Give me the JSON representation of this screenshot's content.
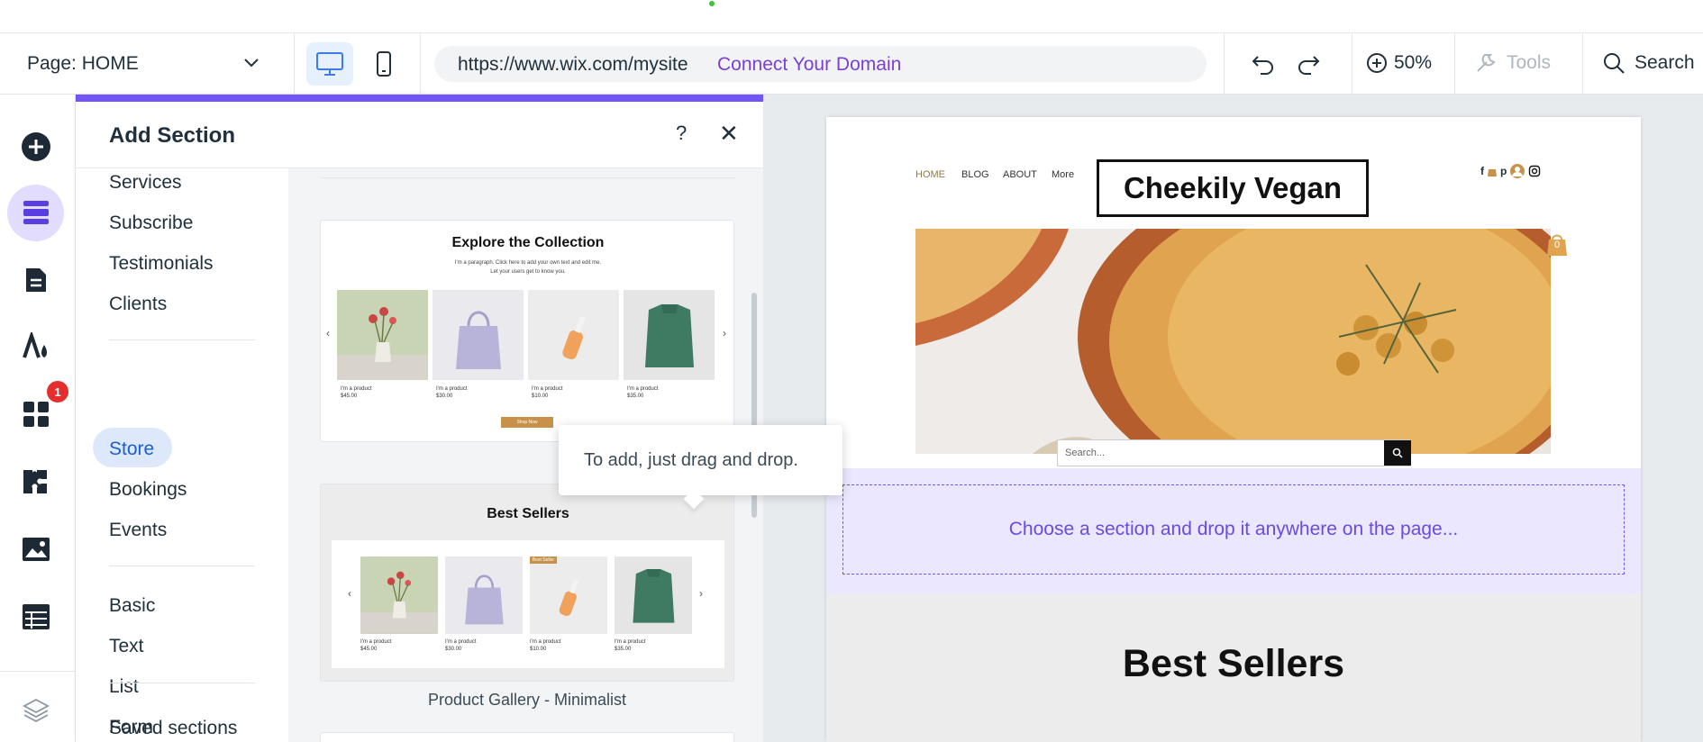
{
  "toolbar": {
    "page_label": "Page: HOME",
    "url": "https://www.wix.com/mysite",
    "connect_domain": "Connect Your Domain",
    "zoom": "50%",
    "tools": "Tools",
    "search": "Search"
  },
  "rail": {
    "apps_badge": "1",
    "icons": [
      "add-icon",
      "sections-icon",
      "pages-icon",
      "design-icon",
      "apps-icon",
      "business-icon",
      "media-icon",
      "cms-icon",
      "layers-icon"
    ]
  },
  "panel": {
    "title": "Add Section",
    "help": "?",
    "close": "✕",
    "categories_group1": [
      "Services",
      "Subscribe",
      "Testimonials",
      "Clients"
    ],
    "categories_group2": [
      "Store",
      "Bookings",
      "Events"
    ],
    "categories_group3": [
      "Basic",
      "Text",
      "List",
      "Form"
    ],
    "saved_sections": "Saved sections",
    "selected_category": "Store"
  },
  "previews": {
    "card1": {
      "title": "Explore the Collection",
      "subtitle_line1": "I'm a paragraph. Click here to add your own text and edit me.",
      "subtitle_line2": "Let your users get to know you.",
      "product_name": "I'm a product",
      "prices": [
        "$45.00",
        "$30.00",
        "$10.00",
        "$35.00"
      ],
      "button": "Shop Now"
    },
    "card2": {
      "title": "Best Sellers",
      "product_name": "I'm a product",
      "prices": [
        "$45.00",
        "$30.00",
        "$10.00",
        "$35.00"
      ],
      "ribbon": "Best Seller",
      "caption": "Product Gallery - Minimalist"
    },
    "tooltip": "To add, just drag and drop."
  },
  "site": {
    "nav": [
      "HOME",
      "BLOG",
      "ABOUT",
      "More"
    ],
    "logo": "Cheekily Vegan",
    "cart_count": "0",
    "search_placeholder": "Search...",
    "drop_hint": "Choose a section and drop it anywhere on the page...",
    "best_sellers": "Best Sellers"
  },
  "colors": {
    "accent_purple": "#7354f6",
    "link_purple": "#7b3fd4",
    "selected_blue": "#dde9fb",
    "badge_red": "#e62e2e"
  }
}
